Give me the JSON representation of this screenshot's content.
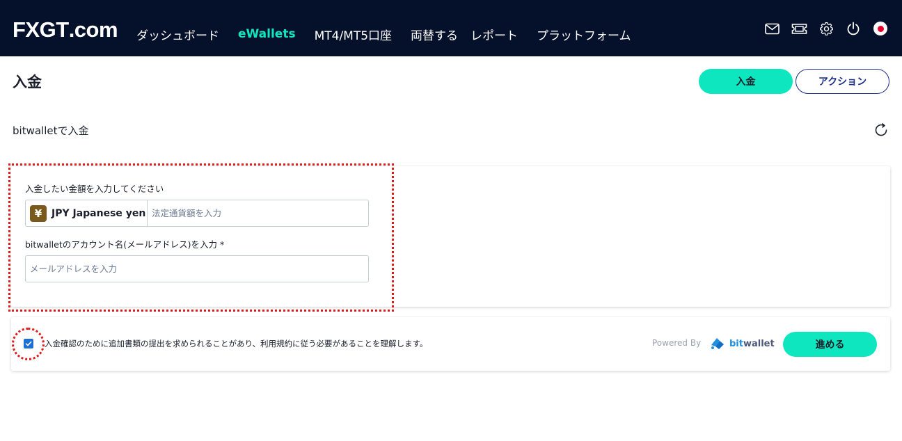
{
  "header": {
    "logo": {
      "prefix": "FX",
      "middle": "GT",
      "suffix": ".com"
    },
    "nav": [
      {
        "label": "ダッシュボード",
        "active": false
      },
      {
        "label": "eWallets",
        "active": true
      },
      {
        "label": "MT4/MT5口座",
        "active": false
      },
      {
        "label": "両替する",
        "active": false
      },
      {
        "label": "レポート",
        "active": false
      },
      {
        "label": "プラットフォーム",
        "active": false
      }
    ],
    "icons": [
      "mail-icon",
      "ticket-icon",
      "gear-icon",
      "power-icon",
      "japan-flag-icon"
    ]
  },
  "page": {
    "title": "入金",
    "deposit_button": "入金",
    "action_button": "アクション",
    "subtitle": "bitwalletで入金"
  },
  "form": {
    "amount_label": "入金したい金額を入力してください",
    "currency_symbol": "¥",
    "currency_name": "JPY Japanese yen",
    "amount_placeholder": "法定通貨額を入力",
    "email_label": "bitwalletのアカウント名(メールアドレス)を入力 *",
    "email_placeholder": "メールアドレスを入力"
  },
  "footer": {
    "checkbox_checked": true,
    "consent_text": "入金確認のために追加書類の提出を求められることがあり、利用規約に従う必要があることを理解します。",
    "powered_by": "Powered By",
    "brand_prefix": "bit",
    "brand_suffix": "wallet",
    "proceed_button": "進める"
  },
  "colors": {
    "header_bg": "#05102b",
    "accent": "#0ee6bf",
    "outline_blue": "#1d2e8a",
    "highlight_red": "#e01a1a"
  }
}
